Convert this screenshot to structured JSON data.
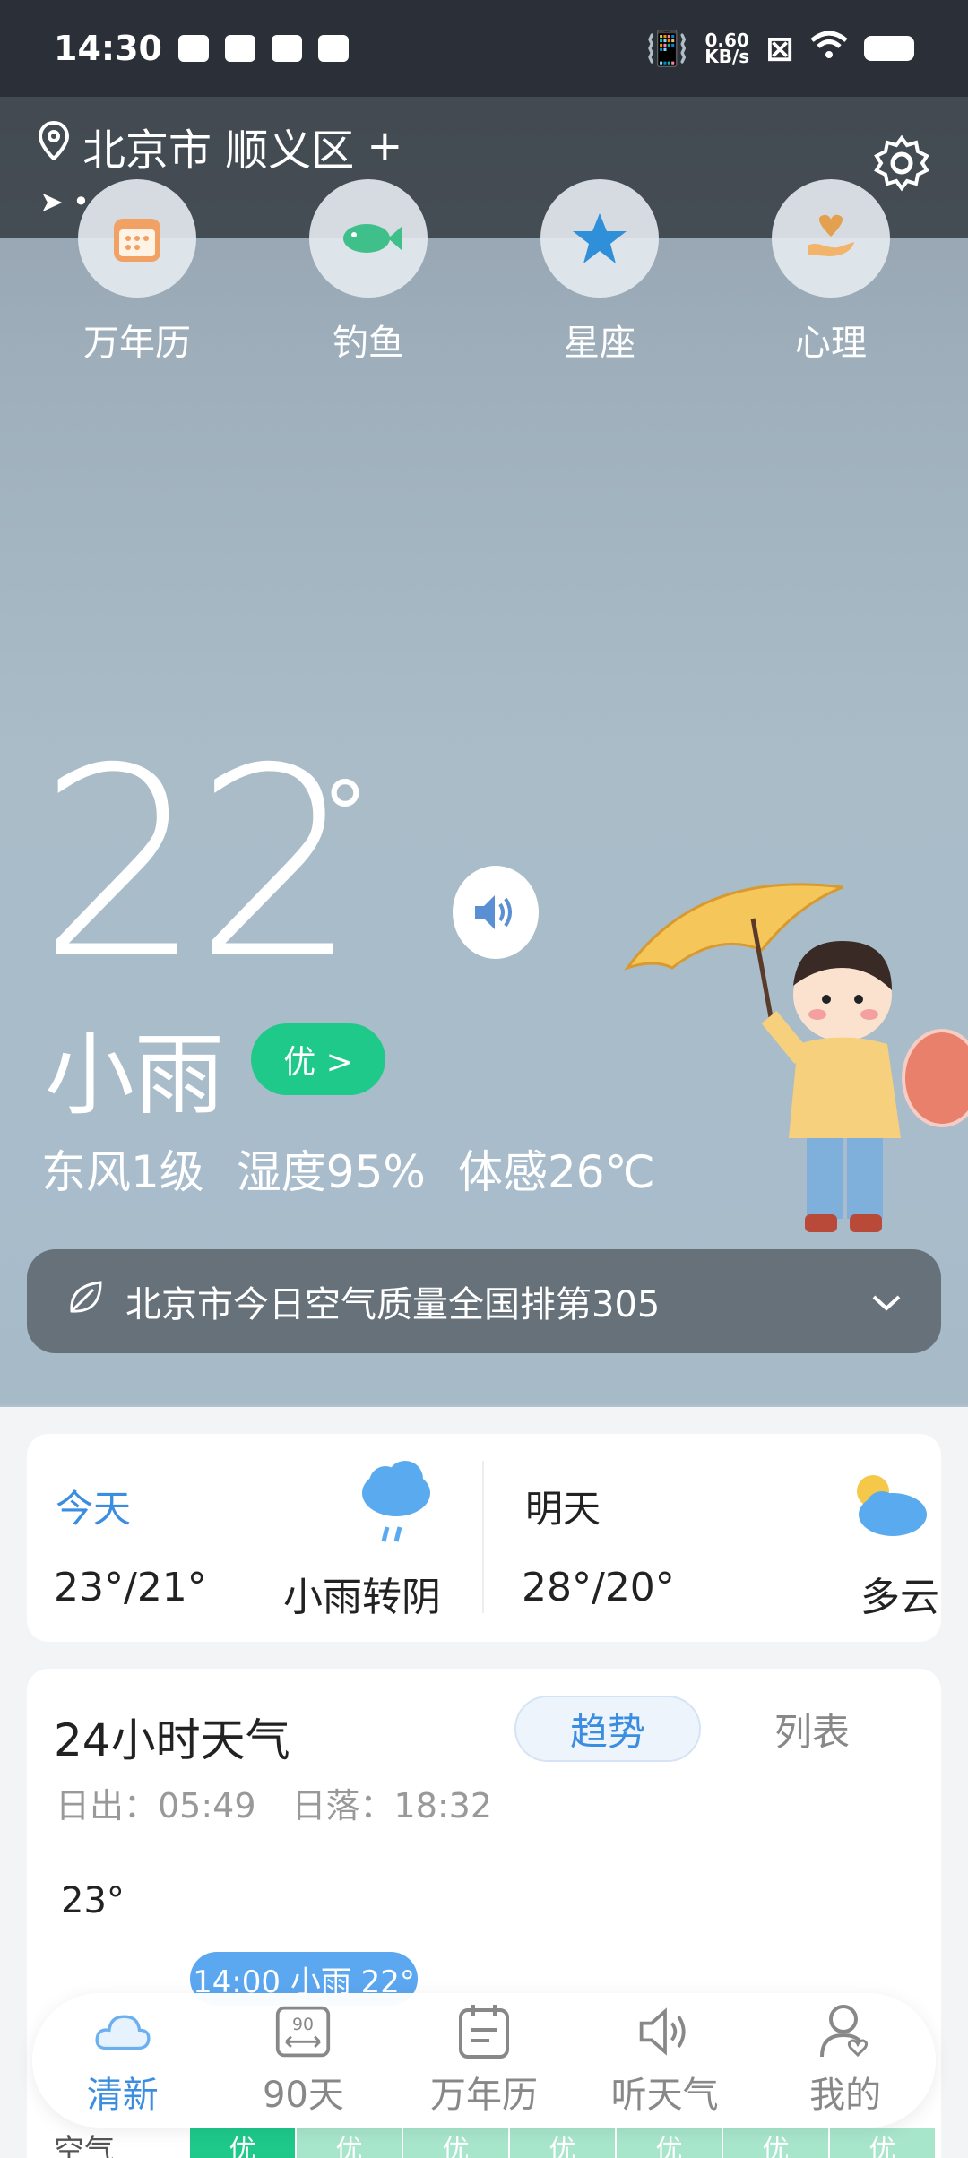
{
  "status_bar": {
    "time": "14:30",
    "network_speed_value": "0.60",
    "network_speed_unit": "KB/s"
  },
  "header": {
    "location": "北京市 顺义区",
    "add_label": "+",
    "settings_icon": "gear-icon"
  },
  "quick_tools": [
    {
      "label": "万年历",
      "icon": "calendar-icon"
    },
    {
      "label": "钓鱼",
      "icon": "fish-icon"
    },
    {
      "label": "星座",
      "icon": "star-icon"
    },
    {
      "label": "心理",
      "icon": "heart-hand-icon"
    }
  ],
  "current": {
    "temperature": "22",
    "degree_symbol": "°",
    "condition": "小雨",
    "aqi_label": "优 >",
    "wind": "东风1级",
    "humidity": "湿度95%",
    "feels_like": "体感26℃"
  },
  "air_quality_banner": {
    "text": "北京市今日空气质量全国排第305"
  },
  "forecast": {
    "today": {
      "label": "今天",
      "temps": "23°/21°",
      "condition": "小雨转阴"
    },
    "tomorrow": {
      "label": "明天",
      "temps": "28°/20°",
      "condition": "多云"
    }
  },
  "hourly": {
    "title": "24小时天气",
    "tab_trend": "趋势",
    "tab_list": "列表",
    "sunrise": "日出：05:49",
    "sunset": "日落：18:32",
    "max_temp": "23°",
    "highlight": "14:00 小雨  22°"
  },
  "air_row": {
    "label": "空气",
    "cells": [
      "优",
      "优",
      "优",
      "优",
      "优",
      "优",
      "优"
    ]
  },
  "tabbar": [
    {
      "label": "清新",
      "icon": "cloud-icon"
    },
    {
      "label": "90天",
      "icon": "ninety-day-icon"
    },
    {
      "label": "万年历",
      "icon": "calendar-icon"
    },
    {
      "label": "听天气",
      "icon": "speaker-icon"
    },
    {
      "label": "我的",
      "icon": "profile-icon"
    }
  ],
  "colors": {
    "accent": "#3a8de0",
    "aqi_good": "#1ec98a",
    "status_bar": "#2b3038"
  }
}
